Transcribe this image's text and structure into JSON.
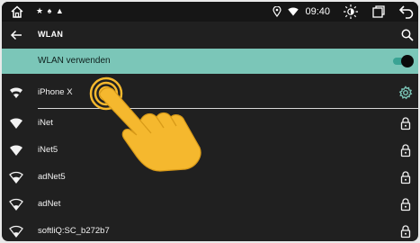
{
  "status_bar": {
    "time": "09:40",
    "notification_icons": "★ ♠ ▲"
  },
  "header": {
    "title": "WLAN"
  },
  "master_toggle": {
    "label": "WLAN verwenden",
    "state": "on",
    "accent_color": "#7bc6b8"
  },
  "networks": [
    {
      "name": "iPhone X",
      "status": "connected",
      "trailing_icon": "settings-icon"
    },
    {
      "name": "iNet",
      "secured": true,
      "trailing_icon": "lock-icon"
    },
    {
      "name": "iNet5",
      "secured": true,
      "trailing_icon": "lock-icon"
    },
    {
      "name": "adNet5",
      "secured": true,
      "trailing_icon": "lock-icon"
    },
    {
      "name": "adNet",
      "secured": true,
      "trailing_icon": "lock-icon"
    },
    {
      "name": "softliQ:SC_b272b7",
      "secured": true,
      "trailing_icon": "lock-icon"
    }
  ],
  "colors": {
    "background": "#202020",
    "status_bar": "#161616",
    "accent": "#7bc6b8",
    "hand": "#f5b82e"
  }
}
